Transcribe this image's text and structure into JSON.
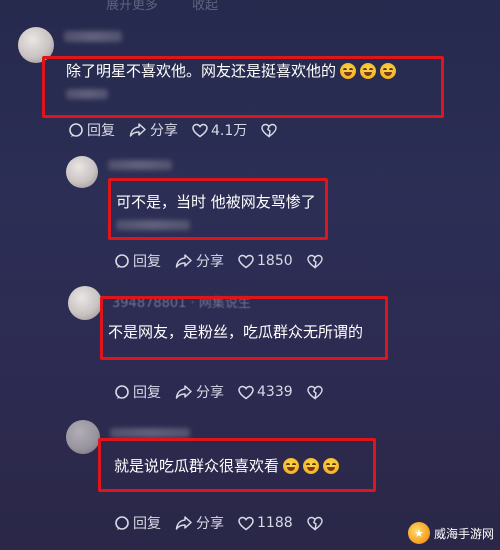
{
  "top": {
    "faded_left": "展开更多",
    "faded_right": "收起"
  },
  "comments": [
    {
      "text": "除了明星不喜欢他。网友还是挺喜欢他的",
      "emojis": [
        "laugh-cry-emoji",
        "laugh-cry-emoji",
        "laugh-cry-emoji"
      ],
      "reply_label": "回复",
      "share_label": "分享",
      "like_count": "4.1万"
    },
    {
      "text": "可不是，当时 他被网友骂惨了",
      "reply_label": "回复",
      "share_label": "分享",
      "like_count": "1850"
    },
    {
      "user_line": "394878801 · 网集说生",
      "text": "不是网友，是粉丝，吃瓜群众无所谓的",
      "reply_label": "回复",
      "share_label": "分享",
      "like_count": "4339"
    },
    {
      "text": "就是说吃瓜群众很喜欢看",
      "emojis": [
        "smile-emoji",
        "smile-emoji",
        "smile-emoji"
      ],
      "reply_label": "回复",
      "share_label": "分享",
      "like_count": "1188"
    }
  ],
  "watermark": {
    "text": "威海手游网"
  },
  "colors": {
    "highlight": "#e0151b",
    "background": "#2a2c52"
  }
}
